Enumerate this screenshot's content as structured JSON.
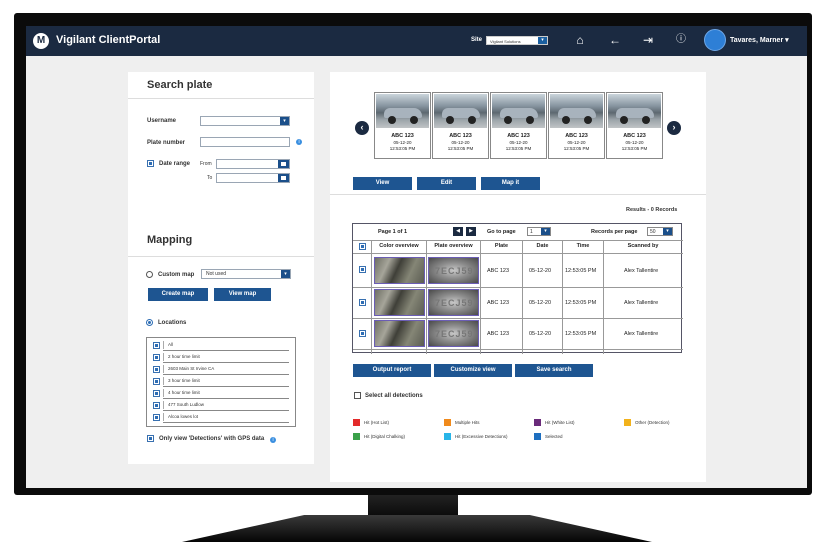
{
  "app": {
    "title": "Vigilant ClientPortal",
    "logo": "M"
  },
  "header": {
    "site_label": "Site",
    "site_value": "Vigilant Solutions",
    "user_name": "Tavares, Marner",
    "icons": [
      "home-icon",
      "back-arrow-icon",
      "logout-icon",
      "info-icon"
    ]
  },
  "search": {
    "title": "Search plate",
    "username_label": "Username",
    "plate_label": "Plate number",
    "date_range_label": "Date range",
    "from_label": "From",
    "to_label": "To"
  },
  "mapping": {
    "title": "Mapping",
    "custom_map_label": "Custom map",
    "custom_map_value": "Not used",
    "create_map": "Create map",
    "view_map": "View map",
    "locations_label": "Locations",
    "locations": [
      "All",
      "2 hour time limit",
      "2603 Main St Irvine CA",
      "3 hour time limit",
      "4 hour time limit",
      "477 South Ludlow",
      "Alcoa lowes lot"
    ],
    "gps_only_label": "Only view 'Detections' with GPS data"
  },
  "carousel": {
    "items": [
      {
        "plate": "ABC 123",
        "date": "05-12-20",
        "time": "12:53:05 PM"
      },
      {
        "plate": "ABC 123",
        "date": "05-12-20",
        "time": "12:53:05 PM"
      },
      {
        "plate": "ABC 123",
        "date": "05-12-20",
        "time": "12:53:05 PM"
      },
      {
        "plate": "ABC 123",
        "date": "05-12-20",
        "time": "12:53:05 PM"
      },
      {
        "plate": "ABC 123",
        "date": "05-12-20",
        "time": "12:53:05 PM"
      }
    ],
    "view": "View",
    "edit": "Edit",
    "map_it": "Map it"
  },
  "results": {
    "count_label": "Results - 0 Records",
    "page_label": "Page 1 of 1",
    "go_to_page_label": "Go to page",
    "go_to_page_value": "1",
    "records_per_page_label": "Records per page",
    "records_per_page_value": "50",
    "columns": [
      "Color overview",
      "Plate overview",
      "Plate",
      "Date",
      "Time",
      "Scanned by"
    ],
    "rows": [
      {
        "plate": "ABC 123",
        "date": "05-12-20",
        "time": "12:53:05 PM",
        "scanned_by": "Alex Tallentire"
      },
      {
        "plate": "ABC 123",
        "date": "05-12-20",
        "time": "12:53:05 PM",
        "scanned_by": "Alex Tallentire"
      },
      {
        "plate": "ABC 123",
        "date": "05-12-20",
        "time": "12:53:05 PM",
        "scanned_by": "Alex Tallentire"
      }
    ],
    "plate_img_text": "7ECJ59"
  },
  "actions": {
    "output_report": "Output report",
    "customize_view": "Customize view",
    "save_search": "Save search",
    "select_all": "Select all detections"
  },
  "legend": [
    {
      "label": "Hit (Hot List)",
      "color": "#e32a2a"
    },
    {
      "label": "Multiple Hits",
      "color": "#f08a1c"
    },
    {
      "label": "Hit (White List)",
      "color": "#6a2b7a"
    },
    {
      "label": "Other (Detection)",
      "color": "#f2b21c"
    },
    {
      "label": "Hit (Digital Chalking)",
      "color": "#3aa14a"
    },
    {
      "label": "Hit (Excessive Detections)",
      "color": "#29b5e8"
    },
    {
      "label": "Selected",
      "color": "#1e6fc0"
    }
  ]
}
